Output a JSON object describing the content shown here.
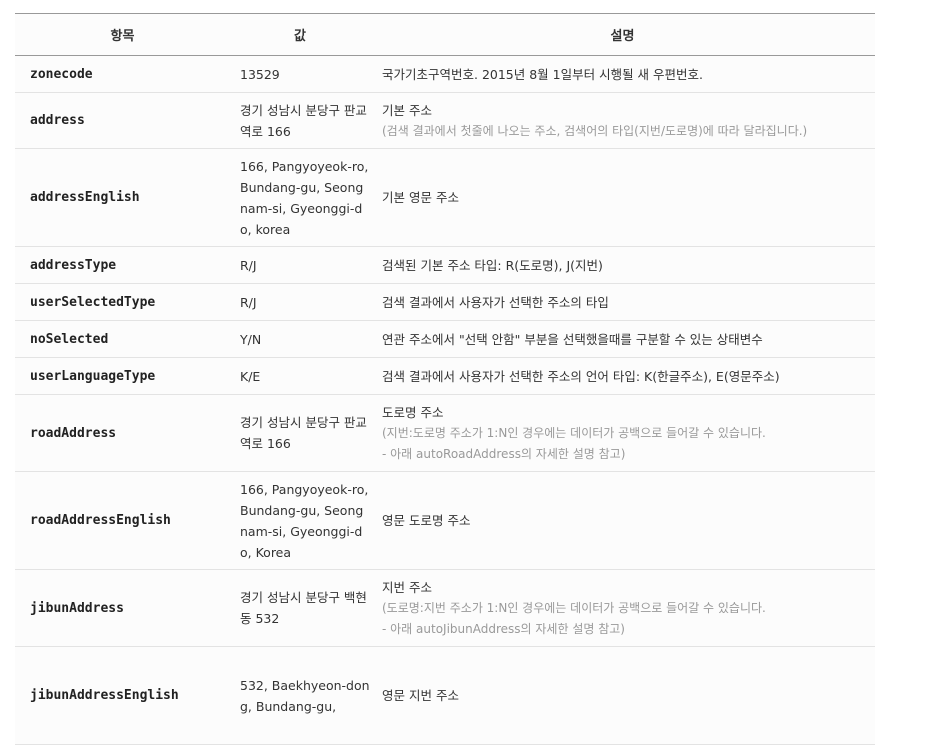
{
  "headers": [
    "항목",
    "값",
    "설명"
  ],
  "rows": [
    {
      "key": "zonecode",
      "value": "13529",
      "desc": "국가기초구역번호. 2015년 8월 1일부터 시행될 새 우편번호.",
      "notes": []
    },
    {
      "key": "address",
      "value": "경기 성남시 분당구 판교역로 166",
      "desc": "기본 주소",
      "notes": [
        "(검색 결과에서 첫줄에 나오는 주소, 검색어의 타입(지번/도로명)에 따라 달라집니다.)"
      ]
    },
    {
      "key": "addressEnglish",
      "value": "166, Pangyoyeok-ro, Bundang-gu, Seongnam-si, Gyeonggi-do, korea",
      "desc": "기본 영문 주소",
      "notes": []
    },
    {
      "key": "addressType",
      "value": "R/J",
      "desc": "검색된 기본 주소 타입: R(도로명), J(지번)",
      "notes": []
    },
    {
      "key": "userSelectedType",
      "value": "R/J",
      "desc": "검색 결과에서 사용자가 선택한 주소의 타입",
      "notes": []
    },
    {
      "key": "noSelected",
      "value": "Y/N",
      "desc": "연관 주소에서 \"선택 안함\" 부분을 선택했을때를 구분할 수 있는 상태변수",
      "notes": []
    },
    {
      "key": "userLanguageType",
      "value": "K/E",
      "desc": "검색 결과에서 사용자가 선택한 주소의 언어 타입: K(한글주소), E(영문주소)",
      "notes": []
    },
    {
      "key": "roadAddress",
      "value": "경기 성남시 분당구 판교역로 166",
      "desc": "도로명 주소",
      "notes": [
        "(지번:도로명 주소가 1:N인 경우에는 데이터가 공백으로 들어갈 수 있습니다.",
        "- 아래 autoRoadAddress의 자세한 설명 참고)"
      ]
    },
    {
      "key": "roadAddressEnglish",
      "value": "166, Pangyoyeok-ro, Bundang-gu, Seongnam-si, Gyeonggi-do, Korea",
      "desc": "영문 도로명 주소",
      "notes": []
    },
    {
      "key": "jibunAddress",
      "value": "경기 성남시 분당구 백현동 532",
      "desc": "지번 주소",
      "notes": [
        "(도로명:지번 주소가 1:N인 경우에는 데이터가 공백으로 들어갈 수 있습니다.",
        "- 아래 autoJibunAddress의 자세한 설명 참고)"
      ]
    },
    {
      "key": "jibunAddressEnglish",
      "value": "532, Baekhyeon-dong, Bundang-gu,",
      "desc": "영문 지번 주소",
      "notes": []
    }
  ]
}
